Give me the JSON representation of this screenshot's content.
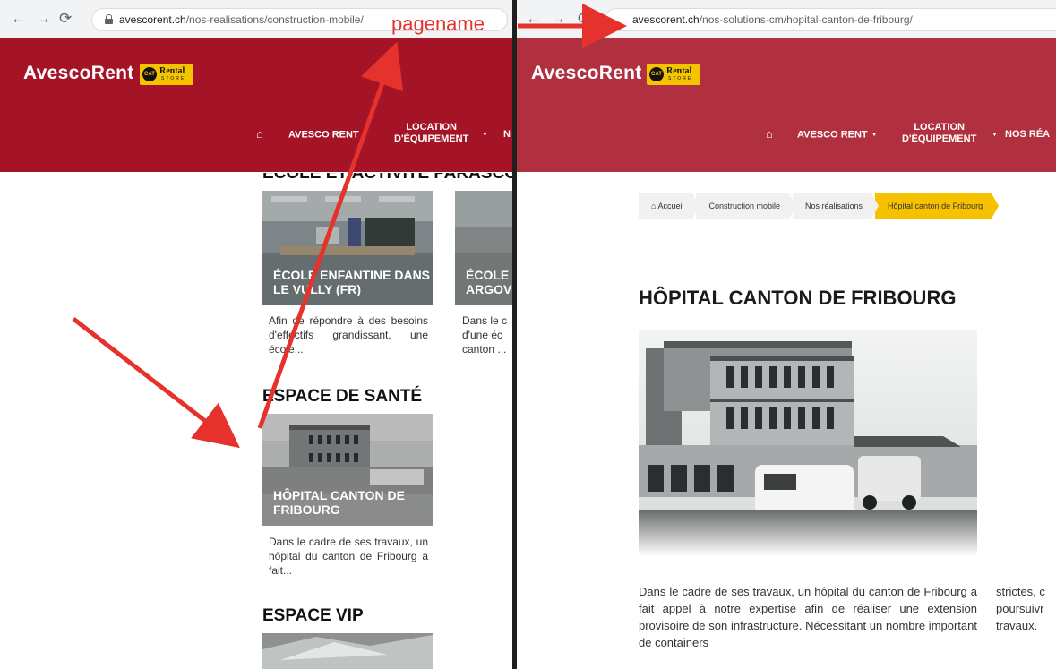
{
  "left": {
    "url_host": "avescorent.ch",
    "url_path": "/nos-realisations/construction-mobile/",
    "brand": "AvescoRent",
    "logo_cat": "CAT",
    "logo_rental": "Rental",
    "logo_store": "STORE",
    "nav": {
      "home_icon": "⌂",
      "item1": "AVESCO RENT",
      "item2_l1": "LOCATION",
      "item2_l2": "D'ÉQUIPEMENT",
      "item3": "N"
    },
    "section1_title": "ÉCOLE ET ACTIVITÉ PARASCOLAIRE",
    "card1": {
      "caption_l1": "ÉCOLE ENFANTINE DANS",
      "caption_l2": "LE VULLY (FR)",
      "text": "Afin de répondre à des besoins d'effectifs grandissant, une école..."
    },
    "card2": {
      "caption_l1": "ÉCOLE",
      "caption_l2": "ARGOV",
      "text_l1": "Dans le c",
      "text_l2": "d'une éc",
      "text_l3": "canton ..."
    },
    "section2_title": "ESPACE DE SANTÉ",
    "card3": {
      "caption_l1": "HÔPITAL CANTON DE",
      "caption_l2": "FRIBOURG",
      "text": "Dans le cadre de ses travaux, un hôpital du canton de Fribourg a fait..."
    },
    "section3_title": "ESPACE VIP"
  },
  "annotation": "pagename",
  "right": {
    "url_host": "avescorent.ch",
    "url_path": "/nos-solutions-cm/hopital-canton-de-fribourg/",
    "brand": "AvescoRent",
    "logo_cat": "CAT",
    "logo_rental": "Rental",
    "logo_store": "STORE",
    "nav": {
      "home_icon": "⌂",
      "item1": "AVESCO RENT",
      "item2_l1": "LOCATION",
      "item2_l2": "D'ÉQUIPEMENT",
      "item3": "NOS RÉA"
    },
    "breadcrumbs": [
      "⌂ Accueil",
      "Construction mobile",
      "Nos réalisations",
      "Hôpital canton de Fribourg"
    ],
    "title": "HÔPITAL CANTON DE FRIBOURG",
    "body_text": "Dans le cadre de ses travaux, un hôpital du canton de Fribourg a fait appel à notre expertise afin de réaliser une extension provisoire de son infrastructure. Nécessitant un nombre important de containers",
    "side_text_l1": "strictes, c",
    "side_text_l2": "poursuivr",
    "side_text_l3": "travaux."
  },
  "colors": {
    "left_header": "#a51426",
    "right_header": "#b1303f",
    "breadcrumb_active": "#f6c200",
    "arrow": "#e5322d"
  }
}
